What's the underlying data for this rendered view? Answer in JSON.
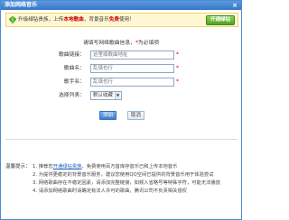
{
  "dialog": {
    "title": "添加网络音乐",
    "close_label": "×"
  },
  "promo": {
    "text_prefix": "升级绿钻贵族，上传",
    "text_highlight1": "本地歌曲",
    "text_middle": "，背景音乐",
    "text_highlight2": "免费",
    "text_suffix": "使用！",
    "button_label": "开通绿钻"
  },
  "form": {
    "hint_prefix": "请填写网络歌曲信息，",
    "hint_star": "*",
    "hint_suffix": "为必填项",
    "fields": [
      {
        "label": "歌曲链接：",
        "value": "",
        "placeholder": "这里填歌曲地址",
        "required": true
      },
      {
        "label": "歌曲名：",
        "value": "",
        "placeholder": "乱填也行",
        "required": true
      },
      {
        "label": "歌手名：",
        "value": "",
        "placeholder": "乱填也行",
        "required": true
      }
    ],
    "playlist": {
      "label": "选择列表：",
      "selected": "默认收藏",
      "arrow": "▼"
    },
    "submit_label": "添加",
    "cancel_label": "取消"
  },
  "notes": {
    "title": "温馨提示：",
    "items": [
      {
        "prefix": "1. 推荐您",
        "link": "开通绿钻贵族",
        "suffix": "，免费使用百万首库存音乐已和上传本地音乐"
      },
      {
        "prefix": "2. 为提供更稳定的背景音乐服务，建议您使用QQ空间已提供的背景音乐用于体验尝试",
        "link": "",
        "suffix": ""
      },
      {
        "prefix": "3. 网络歌曲存在不稳定因素，请添加完整链接，如频入省略号等特殊字符，可能无法播放",
        "link": "",
        "suffix": ""
      },
      {
        "prefix": "4. 请添加网络歌曲时请确定有法人许可的歌曲，腾讯公司不负责相关侵权",
        "link": "",
        "suffix": ""
      }
    ]
  },
  "colors": {
    "title_bar": "#3576c8",
    "promo_bg": "#fff7d2",
    "required": "#d00000",
    "link": "#1a5fb4"
  }
}
